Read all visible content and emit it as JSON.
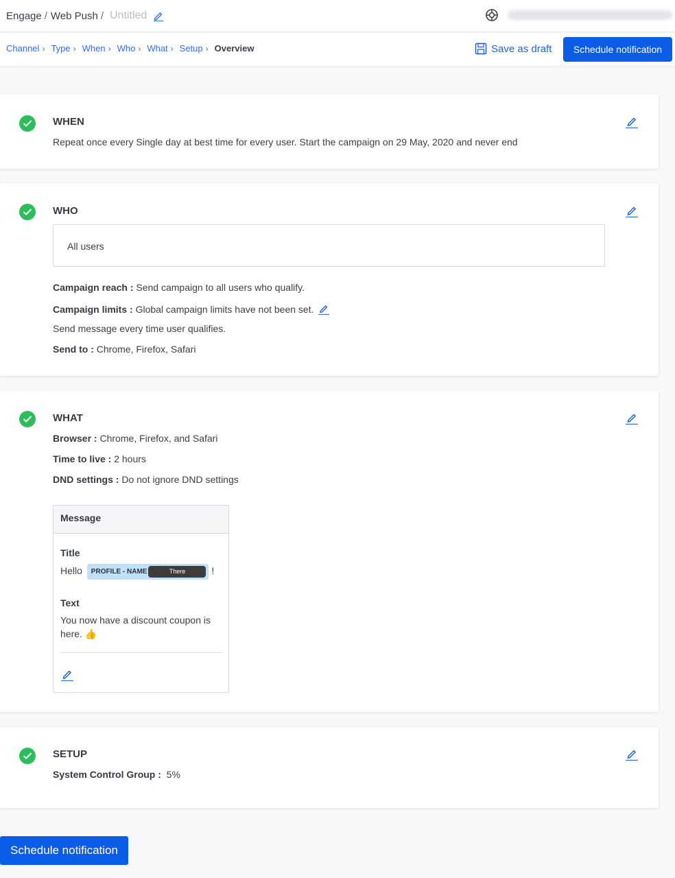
{
  "header": {
    "crumb_engage": "Engage",
    "crumb_webpush": "Web Push",
    "crumb_sep": "/",
    "campaign_name": "Untitled"
  },
  "steps": [
    {
      "label": "Channel"
    },
    {
      "label": "Type"
    },
    {
      "label": "When"
    },
    {
      "label": "Who"
    },
    {
      "label": "What"
    },
    {
      "label": "Setup"
    },
    {
      "label": "Overview"
    }
  ],
  "step_chevron": "›",
  "actions": {
    "save_draft": "Save as draft",
    "schedule": "Schedule notification"
  },
  "when": {
    "title": "WHEN",
    "description": "Repeat once every Single day at best time for every user. Start the campaign on 29 May, 2020 and never end"
  },
  "who": {
    "title": "WHO",
    "segment": "All users",
    "reach_label": "Campaign reach :",
    "reach_value": " Send campaign to all users who qualify.",
    "limits_label": "Campaign limits :",
    "limits_value": " Global campaign limits have not been set.",
    "frequency": "Send message every time user qualifies.",
    "sendto_label": "Send to :",
    "sendto_value": " Chrome, Firefox, Safari"
  },
  "what": {
    "title": "WHAT",
    "browser_label": "Browser :",
    "browser_value": " Chrome, Firefox, and Safari",
    "ttl_label": "Time to live :",
    "ttl_value": " 2 hours",
    "dnd_label": "DND settings :",
    "dnd_value": " Do not ignore DND settings",
    "message": {
      "header": "Message",
      "title_label": "Title",
      "title_prefix": "Hello",
      "tag_key": "PROFILE - NAME",
      "tag_default": "There",
      "title_suffix": "!",
      "text_label": "Text",
      "text_line1": "You now have a discount coupon is",
      "text_line2": "here. 👍"
    }
  },
  "setup": {
    "title": "SETUP",
    "control_label": "System Control Group :",
    "control_value": "  5%"
  },
  "colors": {
    "primary": "#0b5ce6",
    "link": "#2f6fe0",
    "success": "#2ebd5b",
    "tag_bg": "#bfe0f6"
  }
}
